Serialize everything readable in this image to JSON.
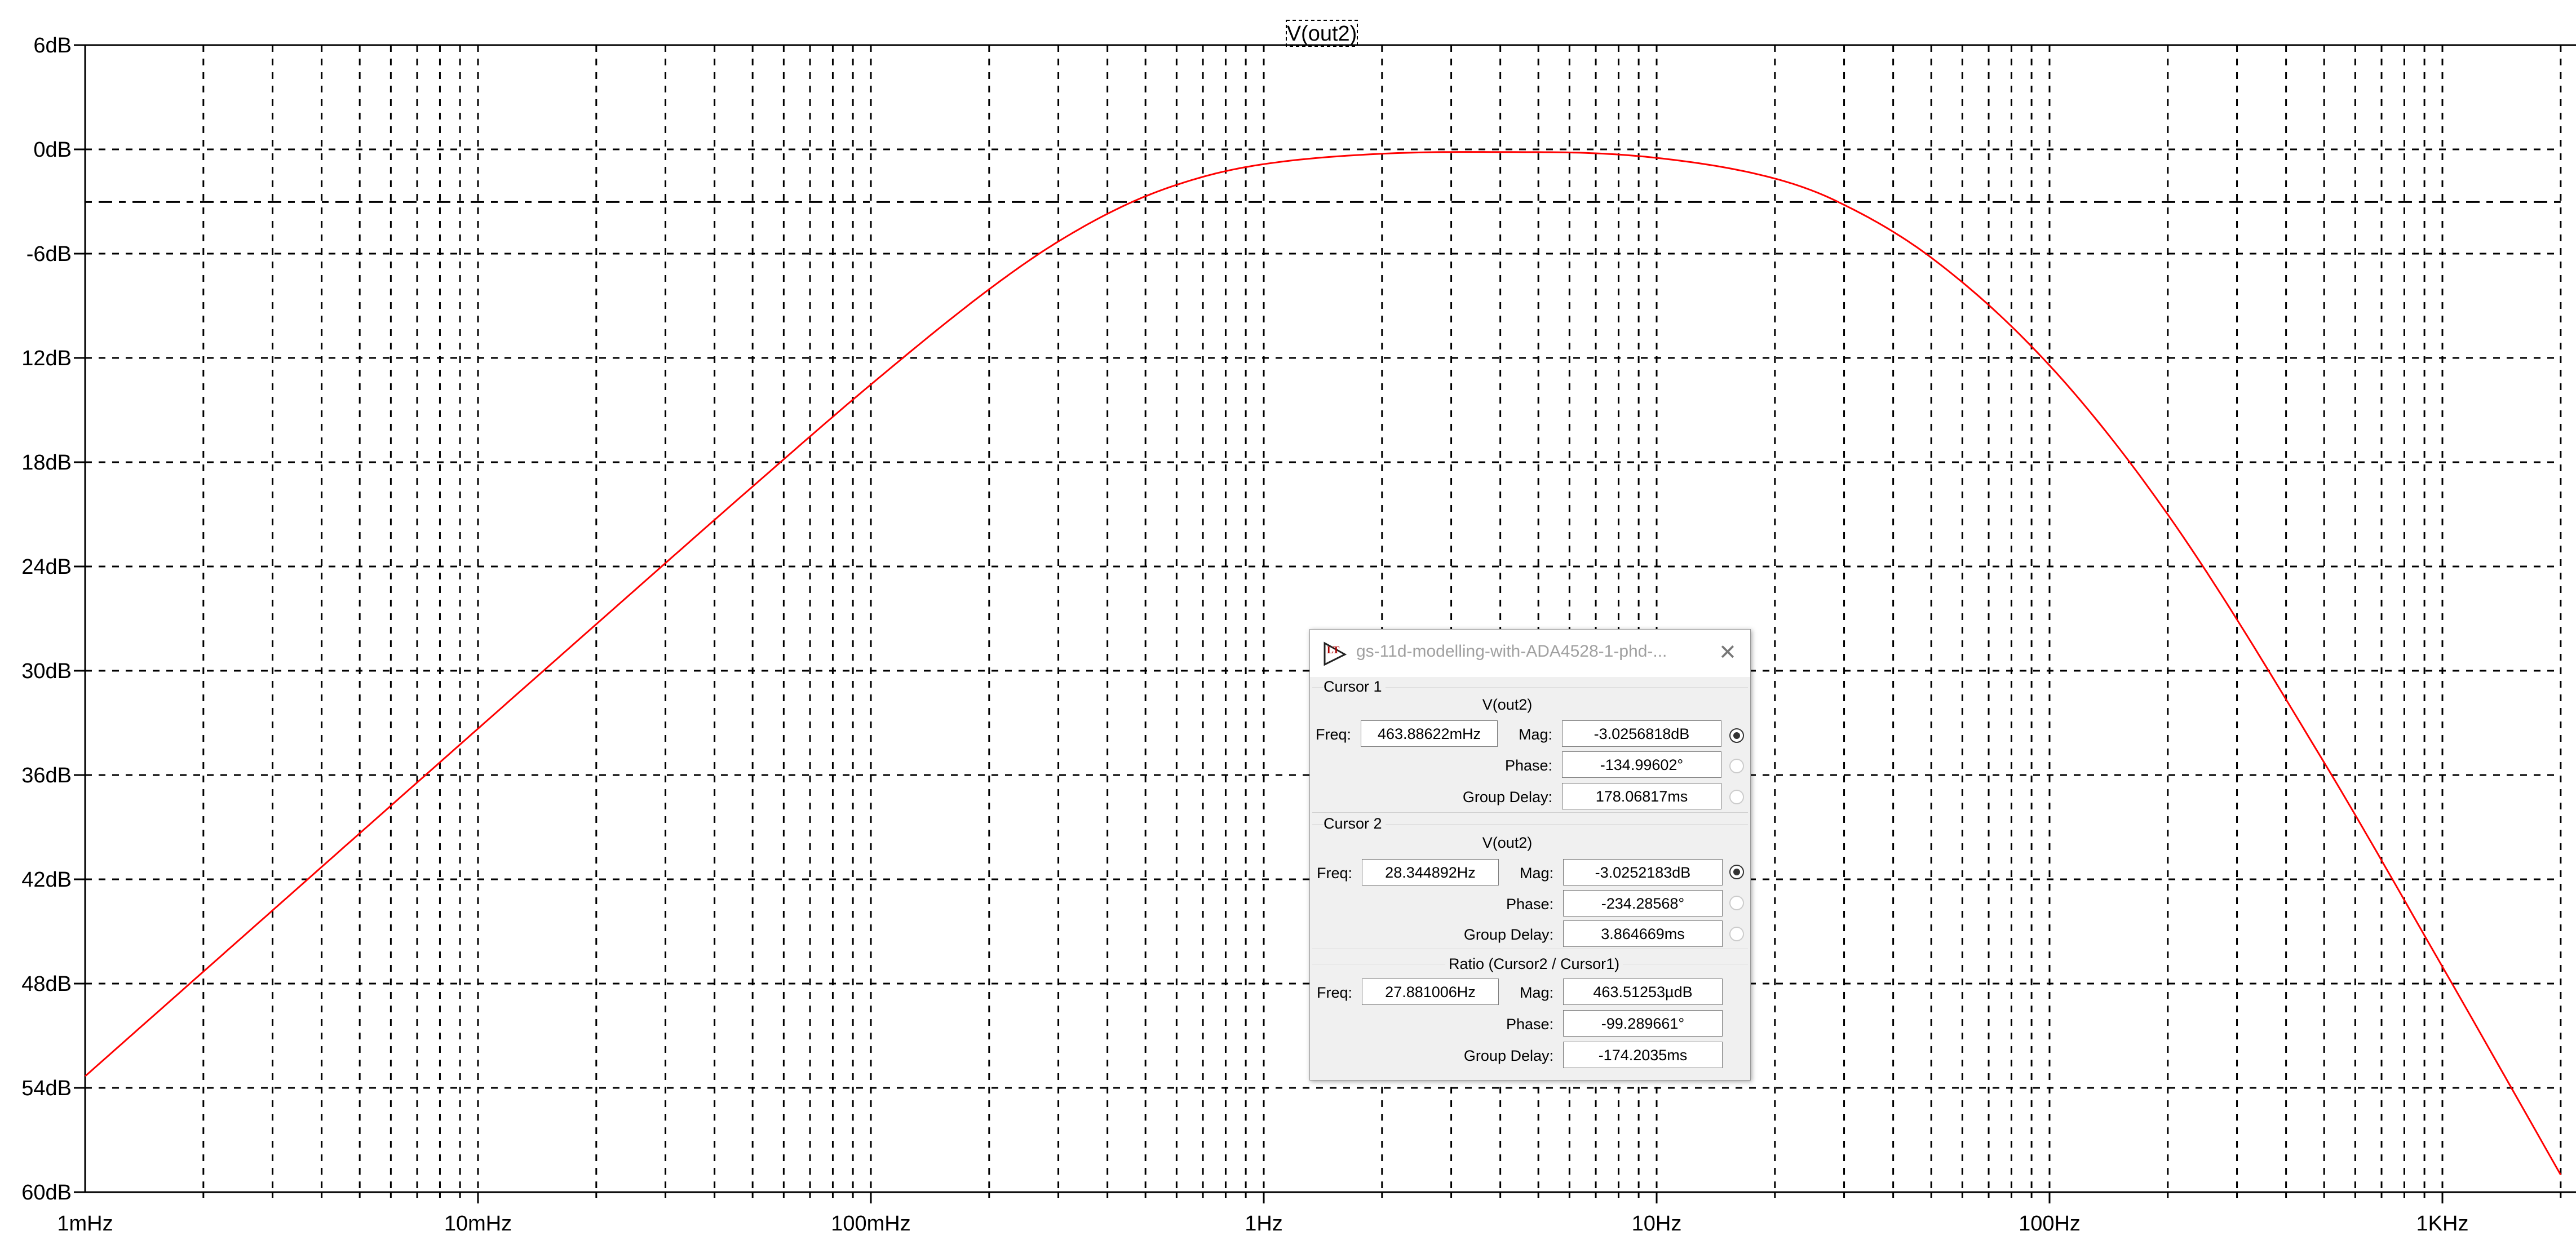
{
  "chart_data": {
    "type": "line",
    "title": "V(out2)",
    "xscale": "log",
    "xlim": [
      0.001,
      2000
    ],
    "ylim": [
      -60,
      6
    ],
    "xlabel": "",
    "ylabel": "",
    "grid": true,
    "x_ticks": [
      {
        "value": 0.001,
        "label": "1mHz"
      },
      {
        "value": 0.01,
        "label": "10mHz"
      },
      {
        "value": 0.1,
        "label": "100mHz"
      },
      {
        "value": 1,
        "label": "1Hz"
      },
      {
        "value": 10,
        "label": "10Hz"
      },
      {
        "value": 100,
        "label": "100Hz"
      },
      {
        "value": 1000,
        "label": "1KHz"
      }
    ],
    "y_ticks": [
      {
        "value": 6,
        "label": "6dB"
      },
      {
        "value": 0,
        "label": "0dB"
      },
      {
        "value": -6,
        "label": "-6dB"
      },
      {
        "value": -12,
        "label": "12dB"
      },
      {
        "value": -18,
        "label": "18dB"
      },
      {
        "value": -24,
        "label": "24dB"
      },
      {
        "value": -30,
        "label": "30dB"
      },
      {
        "value": -36,
        "label": "36dB"
      },
      {
        "value": -42,
        "label": "42dB"
      },
      {
        "value": -48,
        "label": "48dB"
      },
      {
        "value": -54,
        "label": "54dB"
      },
      {
        "value": -60,
        "label": "60dB"
      }
    ],
    "cursor_level_db": -3.03,
    "series": [
      {
        "name": "V(out2)",
        "color": "#ff0000",
        "x": [
          0.001,
          0.002,
          0.005,
          0.01,
          0.02,
          0.05,
          0.1,
          0.2,
          0.3,
          0.464,
          0.7,
          1,
          2,
          5,
          10,
          20,
          28.34,
          50,
          100,
          200,
          500,
          1000,
          2000
        ],
        "y": [
          -53.33,
          -47.31,
          -39.35,
          -33.33,
          -27.32,
          -19.4,
          -13.53,
          -8.05,
          -5.3,
          -3.01,
          -1.58,
          -0.85,
          -0.25,
          -0.16,
          -0.49,
          -1.68,
          -2.92,
          -6.23,
          -12.43,
          -21.01,
          -35.28,
          -47.03,
          -59.0
        ]
      }
    ]
  },
  "dialog": {
    "title": "gs-11d-modelling-with-ADA4528-1-phd-...",
    "cursor1": {
      "label": "Cursor 1",
      "signal": "V(out2)",
      "freq_label": "Freq:",
      "freq": "463.88622mHz",
      "mag_label": "Mag:",
      "mag": "-3.0256818dB",
      "phase_label": "Phase:",
      "phase": "-134.99602°",
      "gd_label": "Group Delay:",
      "gd": "178.06817ms"
    },
    "cursor2": {
      "label": "Cursor 2",
      "signal": "V(out2)",
      "freq_label": "Freq:",
      "freq": "28.344892Hz",
      "mag_label": "Mag:",
      "mag": "-3.0252183dB",
      "phase_label": "Phase:",
      "phase": "-234.28568°",
      "gd_label": "Group Delay:",
      "gd": "3.864669ms"
    },
    "ratio": {
      "label": "Ratio (Cursor2 / Cursor1)",
      "freq_label": "Freq:",
      "freq": "27.881006Hz",
      "mag_label": "Mag:",
      "mag": "463.51253µdB",
      "phase_label": "Phase:",
      "phase": "-99.289661°",
      "gd_label": "Group Delay:",
      "gd": "-174.2035ms"
    }
  }
}
